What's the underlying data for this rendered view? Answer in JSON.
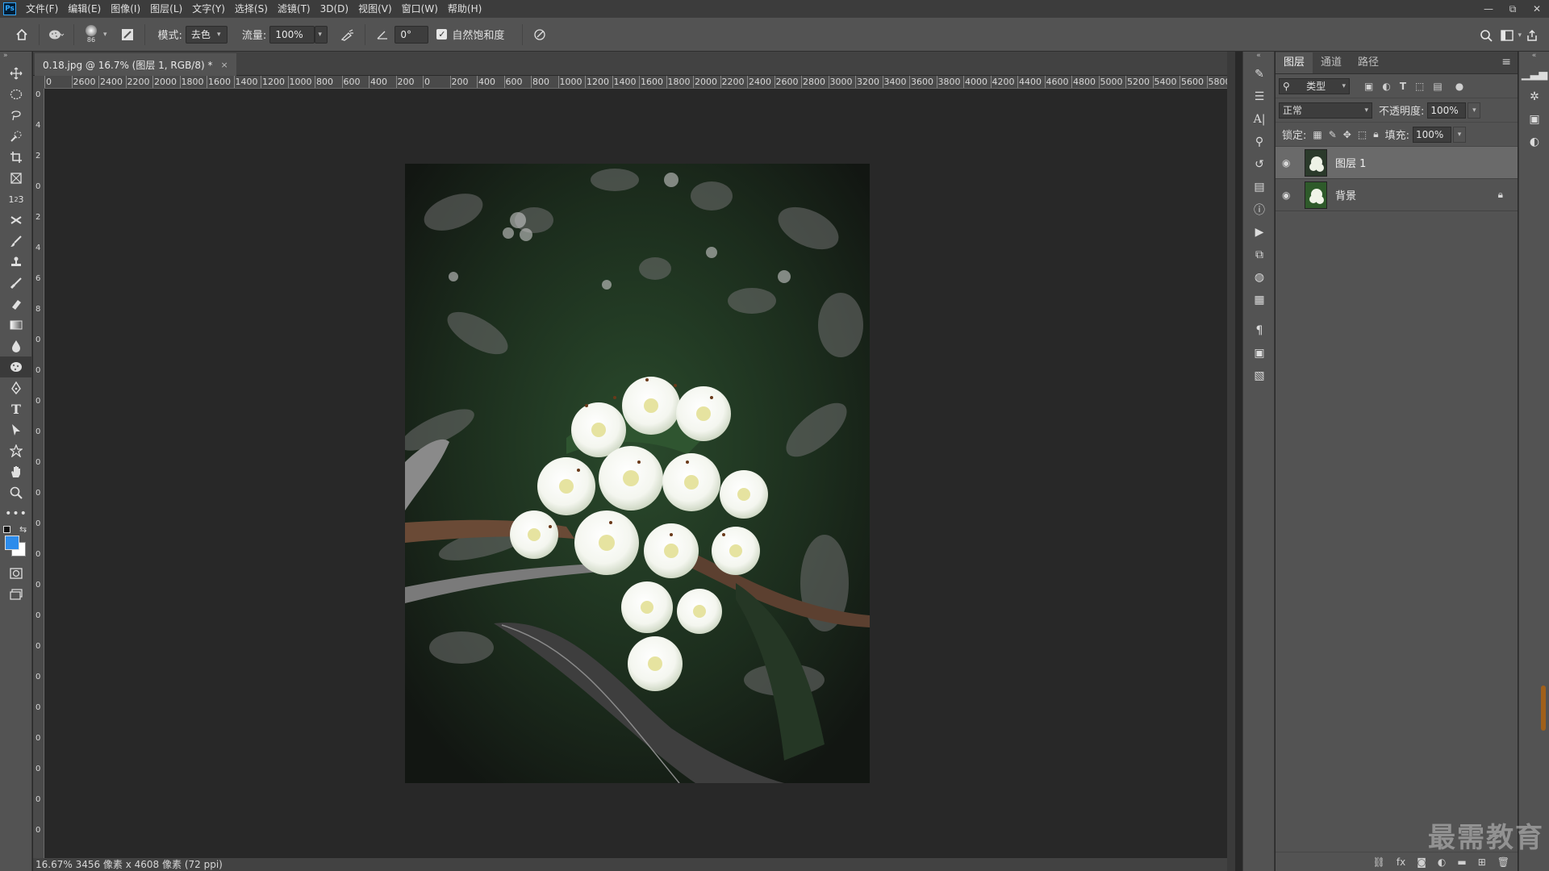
{
  "app": {
    "logo": "Ps"
  },
  "menu": [
    "文件(F)",
    "编辑(E)",
    "图像(I)",
    "图层(L)",
    "文字(Y)",
    "选择(S)",
    "滤镜(T)",
    "3D(D)",
    "视图(V)",
    "窗口(W)",
    "帮助(H)"
  ],
  "window_controls": {
    "minimize": "—",
    "restore": "⧉",
    "close": "✕"
  },
  "options": {
    "brush_size": "86",
    "mode_label": "模式:",
    "mode_value": "去色",
    "flow_label": "流量:",
    "flow_value": "100%",
    "angle_value": "0°",
    "vibrance_label": "自然饱和度",
    "vibrance_checked": true
  },
  "document": {
    "tab_title": "0.18.jpg @ 16.7% (图层 1, RGB/8) *",
    "close": "×"
  },
  "ruler_h": [
    "0",
    "2600",
    "2400",
    "2200",
    "2000",
    "1800",
    "1600",
    "1400",
    "1200",
    "1000",
    "800",
    "600",
    "400",
    "200",
    "0",
    "200",
    "400",
    "600",
    "800",
    "1000",
    "1200",
    "1400",
    "1600",
    "1800",
    "2000",
    "2200",
    "2400",
    "2600",
    "2800",
    "3000",
    "3200",
    "3400",
    "3600",
    "3800",
    "4000",
    "4200",
    "4400",
    "4600",
    "4800",
    "5000",
    "5200",
    "5400",
    "5600",
    "5800",
    "60"
  ],
  "ruler_v": [
    "0",
    "4",
    "2",
    "0",
    "2",
    "4",
    "6",
    "8",
    "0",
    "0",
    "0",
    "0",
    "0",
    "0",
    "0",
    "0",
    "0",
    "0",
    "0",
    "0",
    "0",
    "0",
    "0",
    "0",
    "0"
  ],
  "status": {
    "text": "16.67% 3456 像素 x 4608 像素 (72 ppi)"
  },
  "layers_panel": {
    "tabs": [
      "图层",
      "通道",
      "路径"
    ],
    "filter_kind": "类型",
    "blend_mode": "正常",
    "opacity_label": "不透明度:",
    "opacity_value": "100%",
    "lock_label": "锁定:",
    "fill_label": "填充:",
    "fill_value": "100%",
    "layers": [
      {
        "name": "图层 1",
        "visible": true,
        "selected": true,
        "locked": false
      },
      {
        "name": "背景",
        "visible": true,
        "selected": false,
        "locked": true
      }
    ]
  },
  "watermark": "最需教育",
  "colors": {
    "foreground": "#2d8ceb",
    "background": "#ffffff",
    "accent": "#31a8ff"
  }
}
